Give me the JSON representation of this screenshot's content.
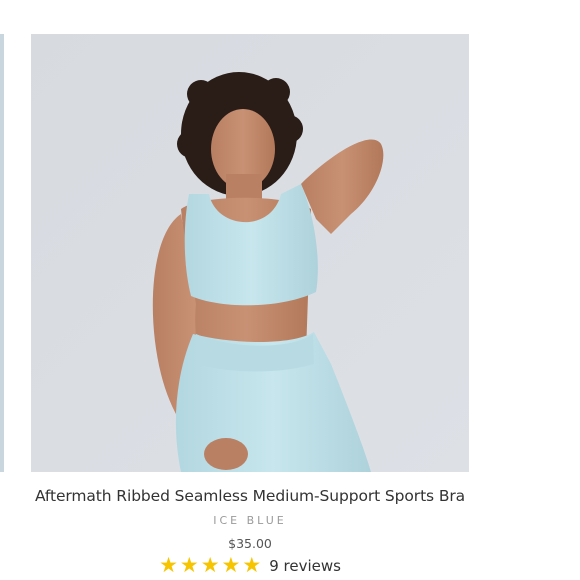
{
  "product": {
    "title": "Aftermath Ribbed Seamless Medium-Support Sports Bra",
    "variant": "ICE BLUE",
    "price": "$35.00",
    "rating": 5,
    "reviews_label": "9 reviews",
    "image_description": "Model wearing ice blue ribbed sports bra and leggings against a light grey backdrop"
  },
  "colors": {
    "star": "#f6c500",
    "garment": "#bfe1e9",
    "backdrop": "#d9dde2"
  },
  "icons": {
    "star": "star-icon"
  }
}
